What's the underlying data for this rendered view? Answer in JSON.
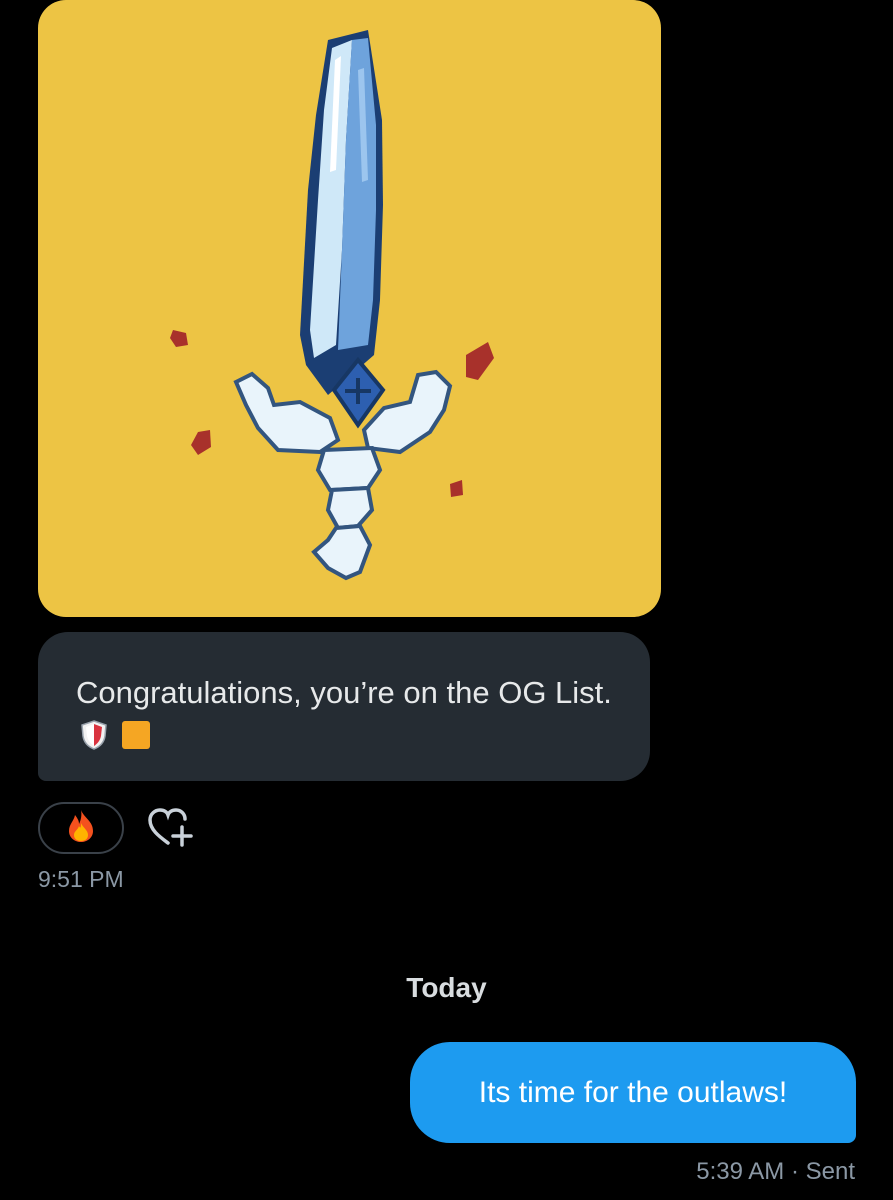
{
  "conversation": {
    "received": {
      "image_description_icon": "sword-image",
      "message_text": "Congratulations, you’re on the OG List.",
      "emoji_icons": [
        "shield-icon",
        "orange-square-icon"
      ],
      "reaction_icon": "fire-icon",
      "add_reaction_icon": "heart-plus-icon",
      "timestamp": "9:51 PM"
    },
    "date_divider": "Today",
    "sent": {
      "message_text": "Its time for the outlaws!",
      "timestamp": "5:39 AM",
      "separator": "·",
      "status": "Sent"
    }
  },
  "colors": {
    "background": "#000000",
    "received_bubble": "#252c33",
    "sent_bubble": "#1d9bf0",
    "media_background": "#edc444",
    "muted_text": "#8b98a5"
  }
}
